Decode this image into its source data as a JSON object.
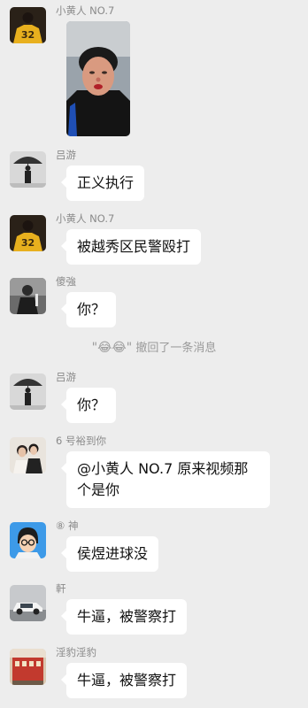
{
  "messages": [
    {
      "sender": "小黄人 NO.7",
      "type": "image",
      "avatar_icon": "jersey-32-avatar"
    },
    {
      "sender": "吕游",
      "type": "text",
      "text": "正义执行",
      "avatar_icon": "umbrella-figure-avatar"
    },
    {
      "sender": "小黄人 NO.7",
      "type": "text",
      "text": "被越秀区民警殴打",
      "avatar_icon": "jersey-32-avatar"
    },
    {
      "sender": "傻強",
      "type": "text",
      "text": "你？",
      "avatar_icon": "dark-figure-avatar"
    },
    {
      "sender": "吕游",
      "type": "text",
      "text": "你？",
      "avatar_icon": "umbrella-figure-avatar"
    },
    {
      "sender": "6 号裕到你",
      "type": "text",
      "text": "@小黄人 NO.7 原来视频那个是你",
      "avatar_icon": "couple-avatar"
    },
    {
      "sender": "⑧ 神",
      "type": "text",
      "text": "侯煜进球没",
      "avatar_icon": "cartoon-glasses-avatar"
    },
    {
      "sender": "軒",
      "type": "text",
      "text": "牛逼，被警察打",
      "avatar_icon": "car-avatar"
    },
    {
      "sender": "淫豹淫豹",
      "type": "text",
      "text": "牛逼，被警察打",
      "avatar_icon": "building-avatar"
    }
  ],
  "system_notice": {
    "emojis": "\"😂😂\"",
    "text": " 撤回了一条消息"
  }
}
